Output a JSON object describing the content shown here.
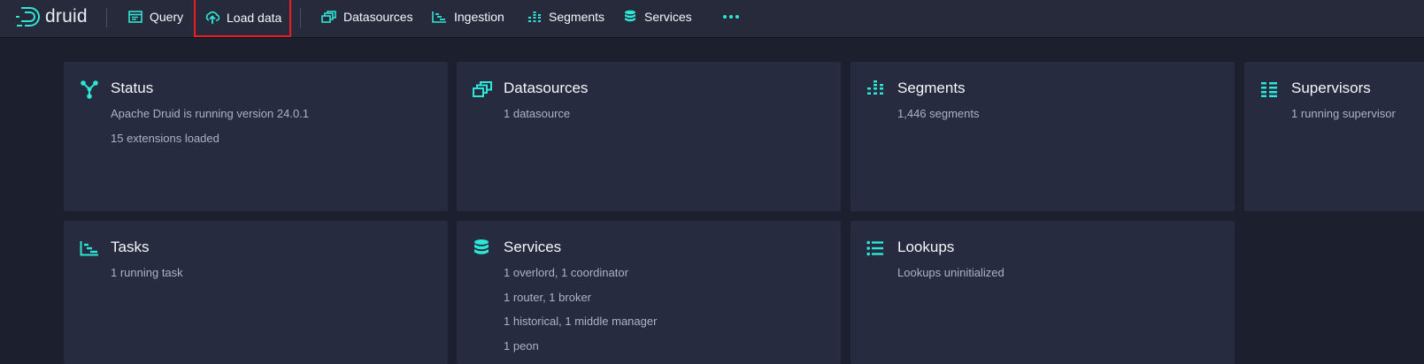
{
  "app": {
    "logo_text": "druid"
  },
  "nav": {
    "items": [
      {
        "label": "Query",
        "icon": "query-icon"
      },
      {
        "label": "Load data",
        "icon": "upload-icon"
      },
      {
        "label": "Datasources",
        "icon": "datasources-icon"
      },
      {
        "label": "Ingestion",
        "icon": "ingestion-icon"
      },
      {
        "label": "Segments",
        "icon": "segments-icon"
      },
      {
        "label": "Services",
        "icon": "database-icon"
      }
    ],
    "more_icon": "more-icon"
  },
  "cards": {
    "status": {
      "title": "Status",
      "lines": [
        "Apache Druid is running version 24.0.1",
        "15 extensions loaded"
      ]
    },
    "datasources": {
      "title": "Datasources",
      "lines": [
        "1 datasource"
      ]
    },
    "segments": {
      "title": "Segments",
      "lines": [
        "1,446 segments"
      ]
    },
    "supervisors": {
      "title": "Supervisors",
      "lines": [
        "1 running supervisor"
      ]
    },
    "tasks": {
      "title": "Tasks",
      "lines": [
        "1 running task"
      ]
    },
    "services": {
      "title": "Services",
      "lines": [
        "1 overlord, 1 coordinator",
        "1 router, 1 broker",
        "1 historical, 1 middle manager",
        "1 peon"
      ]
    },
    "lookups": {
      "title": "Lookups",
      "lines": [
        "Lookups uninitialized"
      ]
    }
  },
  "colors": {
    "accent": "#2ee6d6",
    "highlight": "#ea1c24",
    "card_bg": "#262b40",
    "page_bg": "#1b1f2e"
  }
}
